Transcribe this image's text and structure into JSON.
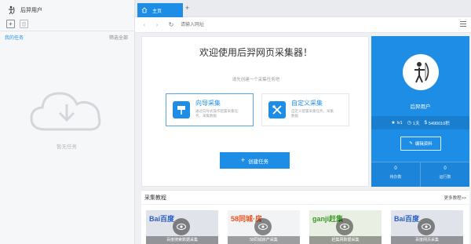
{
  "user": {
    "name": "后羿用户"
  },
  "left": {
    "task_title": "我的任务",
    "task_filter": "筛选全部",
    "empty_text": "暂无任务"
  },
  "tabs": [
    {
      "label": "主页"
    }
  ],
  "address": {
    "placeholder": "请输入网址"
  },
  "welcome": {
    "title": "欢迎使用后羿网页采集器！",
    "subtitle": "请先创建一个采集任务吧",
    "modes": [
      {
        "title": "向导采集",
        "desc": "通过向导式操作配置采集任务，采集数据"
      },
      {
        "title": "自定义采集",
        "desc": "自定义配置采集任务，采集数据"
      }
    ],
    "create_label": "创建任务"
  },
  "card": {
    "name": "后羿用户",
    "stats": [
      {
        "icon": "star-icon",
        "value": "lv1"
      },
      {
        "icon": "clock-icon",
        "value": "1天"
      },
      {
        "icon": "coin-icon",
        "value": "5490010积"
      }
    ],
    "edit_label": "编辑资料",
    "footer": [
      {
        "value": "0",
        "label": "待办数"
      },
      {
        "value": "0",
        "label": "运行数"
      }
    ]
  },
  "tutorial": {
    "title": "采集教程",
    "more": "更多教程>>",
    "items": [
      {
        "brand": "Bai百度",
        "label": "百度搜索数据采集",
        "color": "#e0e4ea",
        "text_color": "#2a5cc6"
      },
      {
        "brand": "58同城·房",
        "label": "58同城房产采集",
        "color": "#f1f3f5",
        "text_color": "#e8551f"
      },
      {
        "brand": "ganji赶集",
        "label": "赶集网数据采集",
        "color": "#e9efe2",
        "text_color": "#3c9a2a"
      },
      {
        "brand": "Bai百度",
        "label": "百度网页采集",
        "color": "#e0e4ea",
        "text_color": "#2a5cc6"
      }
    ]
  },
  "colors": {
    "accent": "#1e8de6"
  }
}
